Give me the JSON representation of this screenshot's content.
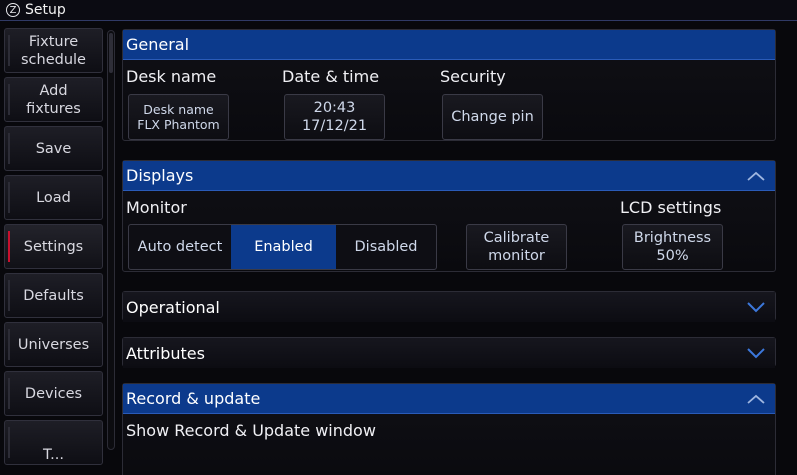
{
  "window": {
    "logo_glyph": "Z",
    "title": "Setup"
  },
  "sidebar": {
    "items": [
      {
        "label": "Fixture\nschedule",
        "active": false
      },
      {
        "label": "Add\nfixtures",
        "active": false
      },
      {
        "label": "Save",
        "active": false
      },
      {
        "label": "Load",
        "active": false
      },
      {
        "label": "Settings",
        "active": true
      },
      {
        "label": "Defaults",
        "active": false
      },
      {
        "label": "Universes",
        "active": false
      },
      {
        "label": "Devices",
        "active": false
      },
      {
        "label": "T...",
        "active": false
      }
    ]
  },
  "general": {
    "header": "General",
    "desk_name_label": "Desk name",
    "desk_name_button": "Desk name\nFLX Phantom",
    "date_time_label": "Date & time",
    "date_time_button_time": "20:43",
    "date_time_button_date": "17/12/21",
    "security_label": "Security",
    "change_pin_button": "Change pin"
  },
  "displays": {
    "header": "Displays",
    "monitor_label": "Monitor",
    "monitor_options": [
      "Auto detect",
      "Enabled",
      "Disabled"
    ],
    "monitor_selected": "Enabled",
    "calibrate_button": "Calibrate\nmonitor",
    "lcd_label": "LCD settings",
    "brightness_button_label": "Brightness",
    "brightness_value": "50%"
  },
  "operational": {
    "header": "Operational"
  },
  "attributes": {
    "header": "Attributes"
  },
  "record_update": {
    "header": "Record & update",
    "show_window_label": "Show Record & Update window"
  },
  "colors": {
    "header_blue": "#0c3a8c",
    "active_red": "#c8102e",
    "chevron_blue": "#3c78dc"
  }
}
